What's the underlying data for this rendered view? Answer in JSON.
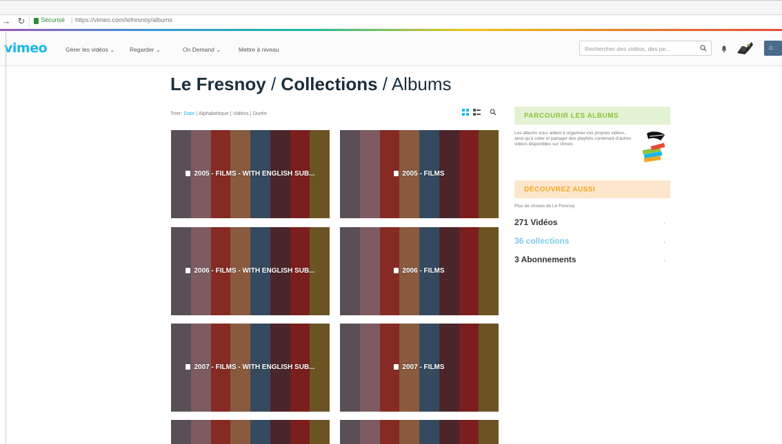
{
  "browser": {
    "secure_label": "Sécurisé",
    "url": "https://vimeo.com/lefresnoy/albums"
  },
  "header": {
    "logo": "vimeo",
    "menu": [
      "Gérer les vidéos ⌄",
      "Regarder ⌄",
      "On Demand ⌄",
      "Mettre à niveau"
    ],
    "search_placeholder": "Rechercher des vidéos, des pe..."
  },
  "page": {
    "title_owner": "Le Fresnoy",
    "title_sep1": "/",
    "title_section": "Collections",
    "title_sep2": "/",
    "title_leaf": "Albums"
  },
  "sortbar": {
    "prefix": "Trier:",
    "options": [
      "Date",
      "Alphabétique",
      "Vidéos",
      "Durée"
    ],
    "active_index": 0
  },
  "albums": [
    {
      "title": "2005 - FILMS - WITH ENGLISH SUB..."
    },
    {
      "title": "2005 - FILMS"
    },
    {
      "title": "2006 - FILMS - WITH ENGLISH SUB..."
    },
    {
      "title": "2006 - FILMS"
    },
    {
      "title": "2007 - FILMS - WITH ENGLISH SUB..."
    },
    {
      "title": "2007 - FILMS"
    },
    {
      "title": ""
    },
    {
      "title": ""
    }
  ],
  "stripe_colors": [
    "#5a4f57",
    "#7d5b60",
    "#862a24",
    "#8a5a3e",
    "#364a5f",
    "#4a252a",
    "#7a1f1e",
    "#6b5324"
  ],
  "sidebar": {
    "browse_title": "PARCOURIR LES ALBUMS",
    "browse_desc": "Les albums vous aident à organiser vos propres vidéos, ainsi qu'à créer et partager des playlists contenant d'autres vidéos disponibles sur Vimeo.",
    "discover_title": "DÉCOUVREZ AUSSI",
    "more_from": "Plus de choses de Le Fresnoy",
    "stats": [
      {
        "label": "271 Vidéos",
        "link": false
      },
      {
        "label": "36 collections",
        "link": true
      },
      {
        "label": "3 Abonnements",
        "link": false
      }
    ]
  },
  "colors": {
    "accent": "#1ab7ea",
    "green_head": "#8fc13a",
    "orange_head": "#f5a524"
  }
}
